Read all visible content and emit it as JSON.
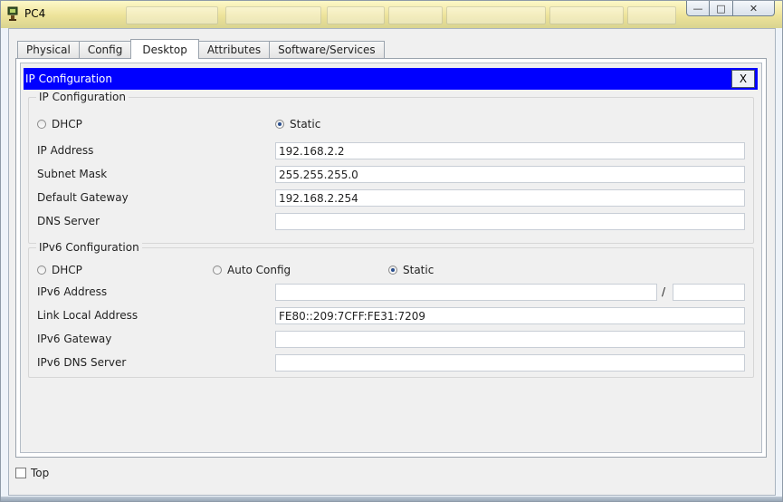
{
  "window": {
    "title": "PC4",
    "icon": "pc-device-icon",
    "controls": {
      "minimize": "—",
      "maximize": "□",
      "close": "✕"
    }
  },
  "tabs": [
    {
      "label": "Physical",
      "active": false
    },
    {
      "label": "Config",
      "active": false
    },
    {
      "label": "Desktop",
      "active": true
    },
    {
      "label": "Attributes",
      "active": false
    },
    {
      "label": "Software/Services",
      "active": false
    }
  ],
  "dialog": {
    "title": "IP Configuration",
    "close_label": "X"
  },
  "ipv4": {
    "group_title": "IP Configuration",
    "dhcp_label": "DHCP",
    "static_label": "Static",
    "selected_mode": "Static",
    "ip_address_label": "IP Address",
    "ip_address_value": "192.168.2.2",
    "subnet_mask_label": "Subnet Mask",
    "subnet_mask_value": "255.255.255.0",
    "default_gateway_label": "Default Gateway",
    "default_gateway_value": "192.168.2.254",
    "dns_server_label": "DNS Server",
    "dns_server_value": ""
  },
  "ipv6": {
    "group_title": "IPv6 Configuration",
    "dhcp_label": "DHCP",
    "auto_label": "Auto Config",
    "static_label": "Static",
    "selected_mode": "Static",
    "address_label": "IPv6 Address",
    "address_value": "",
    "prefix_separator": "/",
    "prefix_value": "",
    "link_local_label": "Link Local Address",
    "link_local_value": "FE80::209:7CFF:FE31:7209",
    "gateway_label": "IPv6 Gateway",
    "gateway_value": "",
    "dns_label": "IPv6 DNS Server",
    "dns_value": ""
  },
  "footer": {
    "top_label": "Top",
    "top_checked": false
  },
  "colors": {
    "dialog_header": "#0000ff",
    "titlebar": "#ede39a"
  }
}
